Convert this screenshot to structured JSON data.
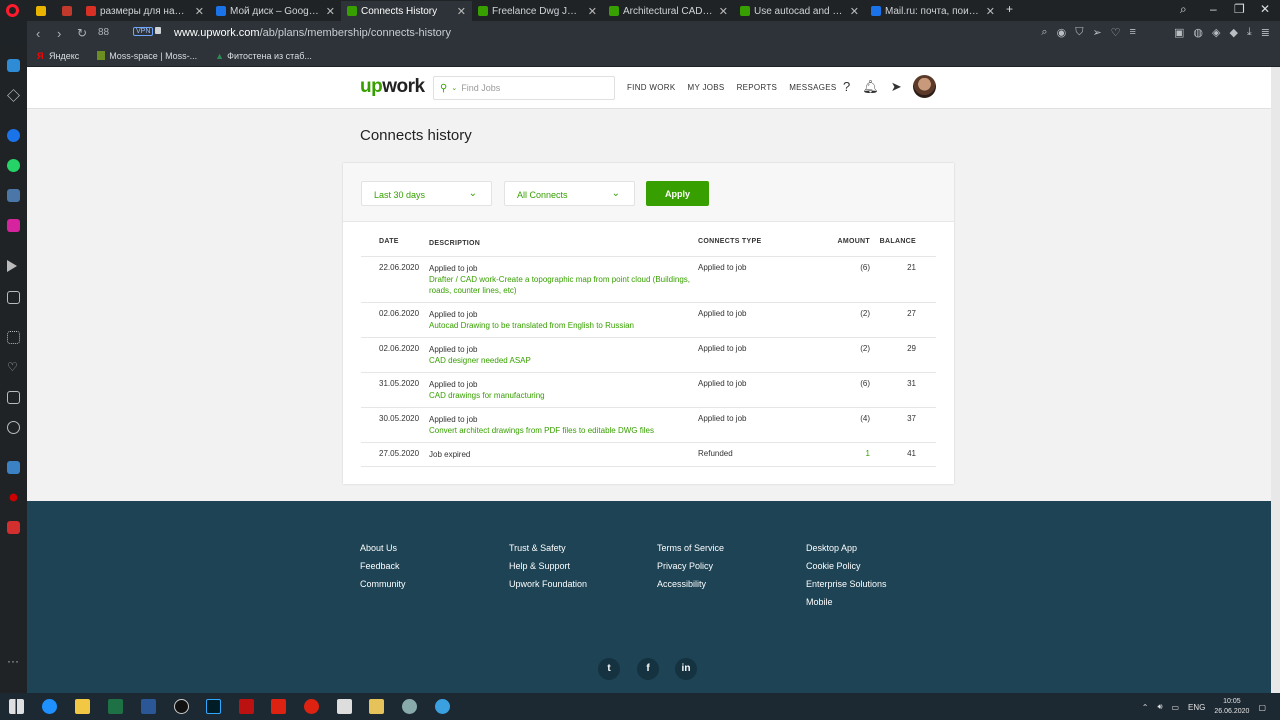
{
  "browser": {
    "tabs": [
      {
        "title": "размеры для нанесения с",
        "color": "#d93025"
      },
      {
        "title": "Мой диск – Google Диск",
        "color": "#1a73e8"
      },
      {
        "title": "Connects History",
        "color": "#37a000",
        "active": true
      },
      {
        "title": "Freelance Dwg Jobs Online",
        "color": "#37a000"
      },
      {
        "title": "Architectural CAD Drawing",
        "color": "#37a000"
      },
      {
        "title": "Use autocad and sketch up",
        "color": "#37a000"
      },
      {
        "title": "Mail.ru: почта, поиск в ин",
        "color": "#1a73e8"
      }
    ],
    "speed_dial_count": "88",
    "vpn_label": "VPN",
    "url_host": "www.upwork.com",
    "url_path": "/ab/plans/membership/connects-history",
    "bookmarks": [
      "Яндекс",
      "Moss-space | Moss-...",
      "Фитостена из стаб..."
    ]
  },
  "header": {
    "logo_left": "up",
    "logo_right": "work",
    "search_placeholder": "Find Jobs",
    "nav": [
      "FIND WORK",
      "MY JOBS",
      "REPORTS",
      "MESSAGES"
    ],
    "help_icon": "?"
  },
  "page_title": "Connects history",
  "filters": {
    "period": "Last 30 days",
    "connects": "All Connects",
    "apply_label": "Apply"
  },
  "table": {
    "headers": [
      "DATE",
      "DESCRIPTION",
      "CONNECTS TYPE",
      "AMOUNT",
      "BALANCE"
    ],
    "rows": [
      {
        "date": "22.06.2020",
        "desc": "Applied to job",
        "link": "Drafter / CAD work-Create a topographic map from point cloud (Buildings, roads, counter lines, etc)",
        "type": "Applied to job",
        "amount": "(6)",
        "balance": "21"
      },
      {
        "date": "02.06.2020",
        "desc": "Applied to job",
        "link": "Autocad Drawing to be translated from English to Russian",
        "type": "Applied to job",
        "amount": "(2)",
        "balance": "27"
      },
      {
        "date": "02.06.2020",
        "desc": "Applied to job",
        "link": "CAD designer needed ASAP",
        "type": "Applied to job",
        "amount": "(2)",
        "balance": "29"
      },
      {
        "date": "31.05.2020",
        "desc": "Applied to job",
        "link": "CAD drawings for manufacturing",
        "type": "Applied to job",
        "amount": "(6)",
        "balance": "31"
      },
      {
        "date": "30.05.2020",
        "desc": "Applied to job",
        "link": "Convert architect drawings from PDF files to editable DWG files",
        "type": "Applied to job",
        "amount": "(4)",
        "balance": "37"
      },
      {
        "date": "27.05.2020",
        "desc": "Job expired",
        "link": "",
        "type": "Refunded",
        "amount": "1",
        "balance": "41"
      }
    ]
  },
  "footer": {
    "col1": [
      "About Us",
      "Feedback",
      "Community"
    ],
    "col2": [
      "Trust & Safety",
      "Help & Support",
      "Upwork Foundation"
    ],
    "col3": [
      "Terms of Service",
      "Privacy Policy",
      "Accessibility"
    ],
    "col4": [
      "Desktop App",
      "Cookie Policy",
      "Enterprise Solutions",
      "Mobile"
    ],
    "social": [
      "twitter-icon",
      "facebook-icon",
      "linkedin-icon"
    ]
  },
  "taskbar": {
    "lang": "ENG",
    "time": "10:05",
    "date": "26.06.2020"
  },
  "colors": {
    "brand": "#37a000",
    "footer": "#1d4354"
  }
}
